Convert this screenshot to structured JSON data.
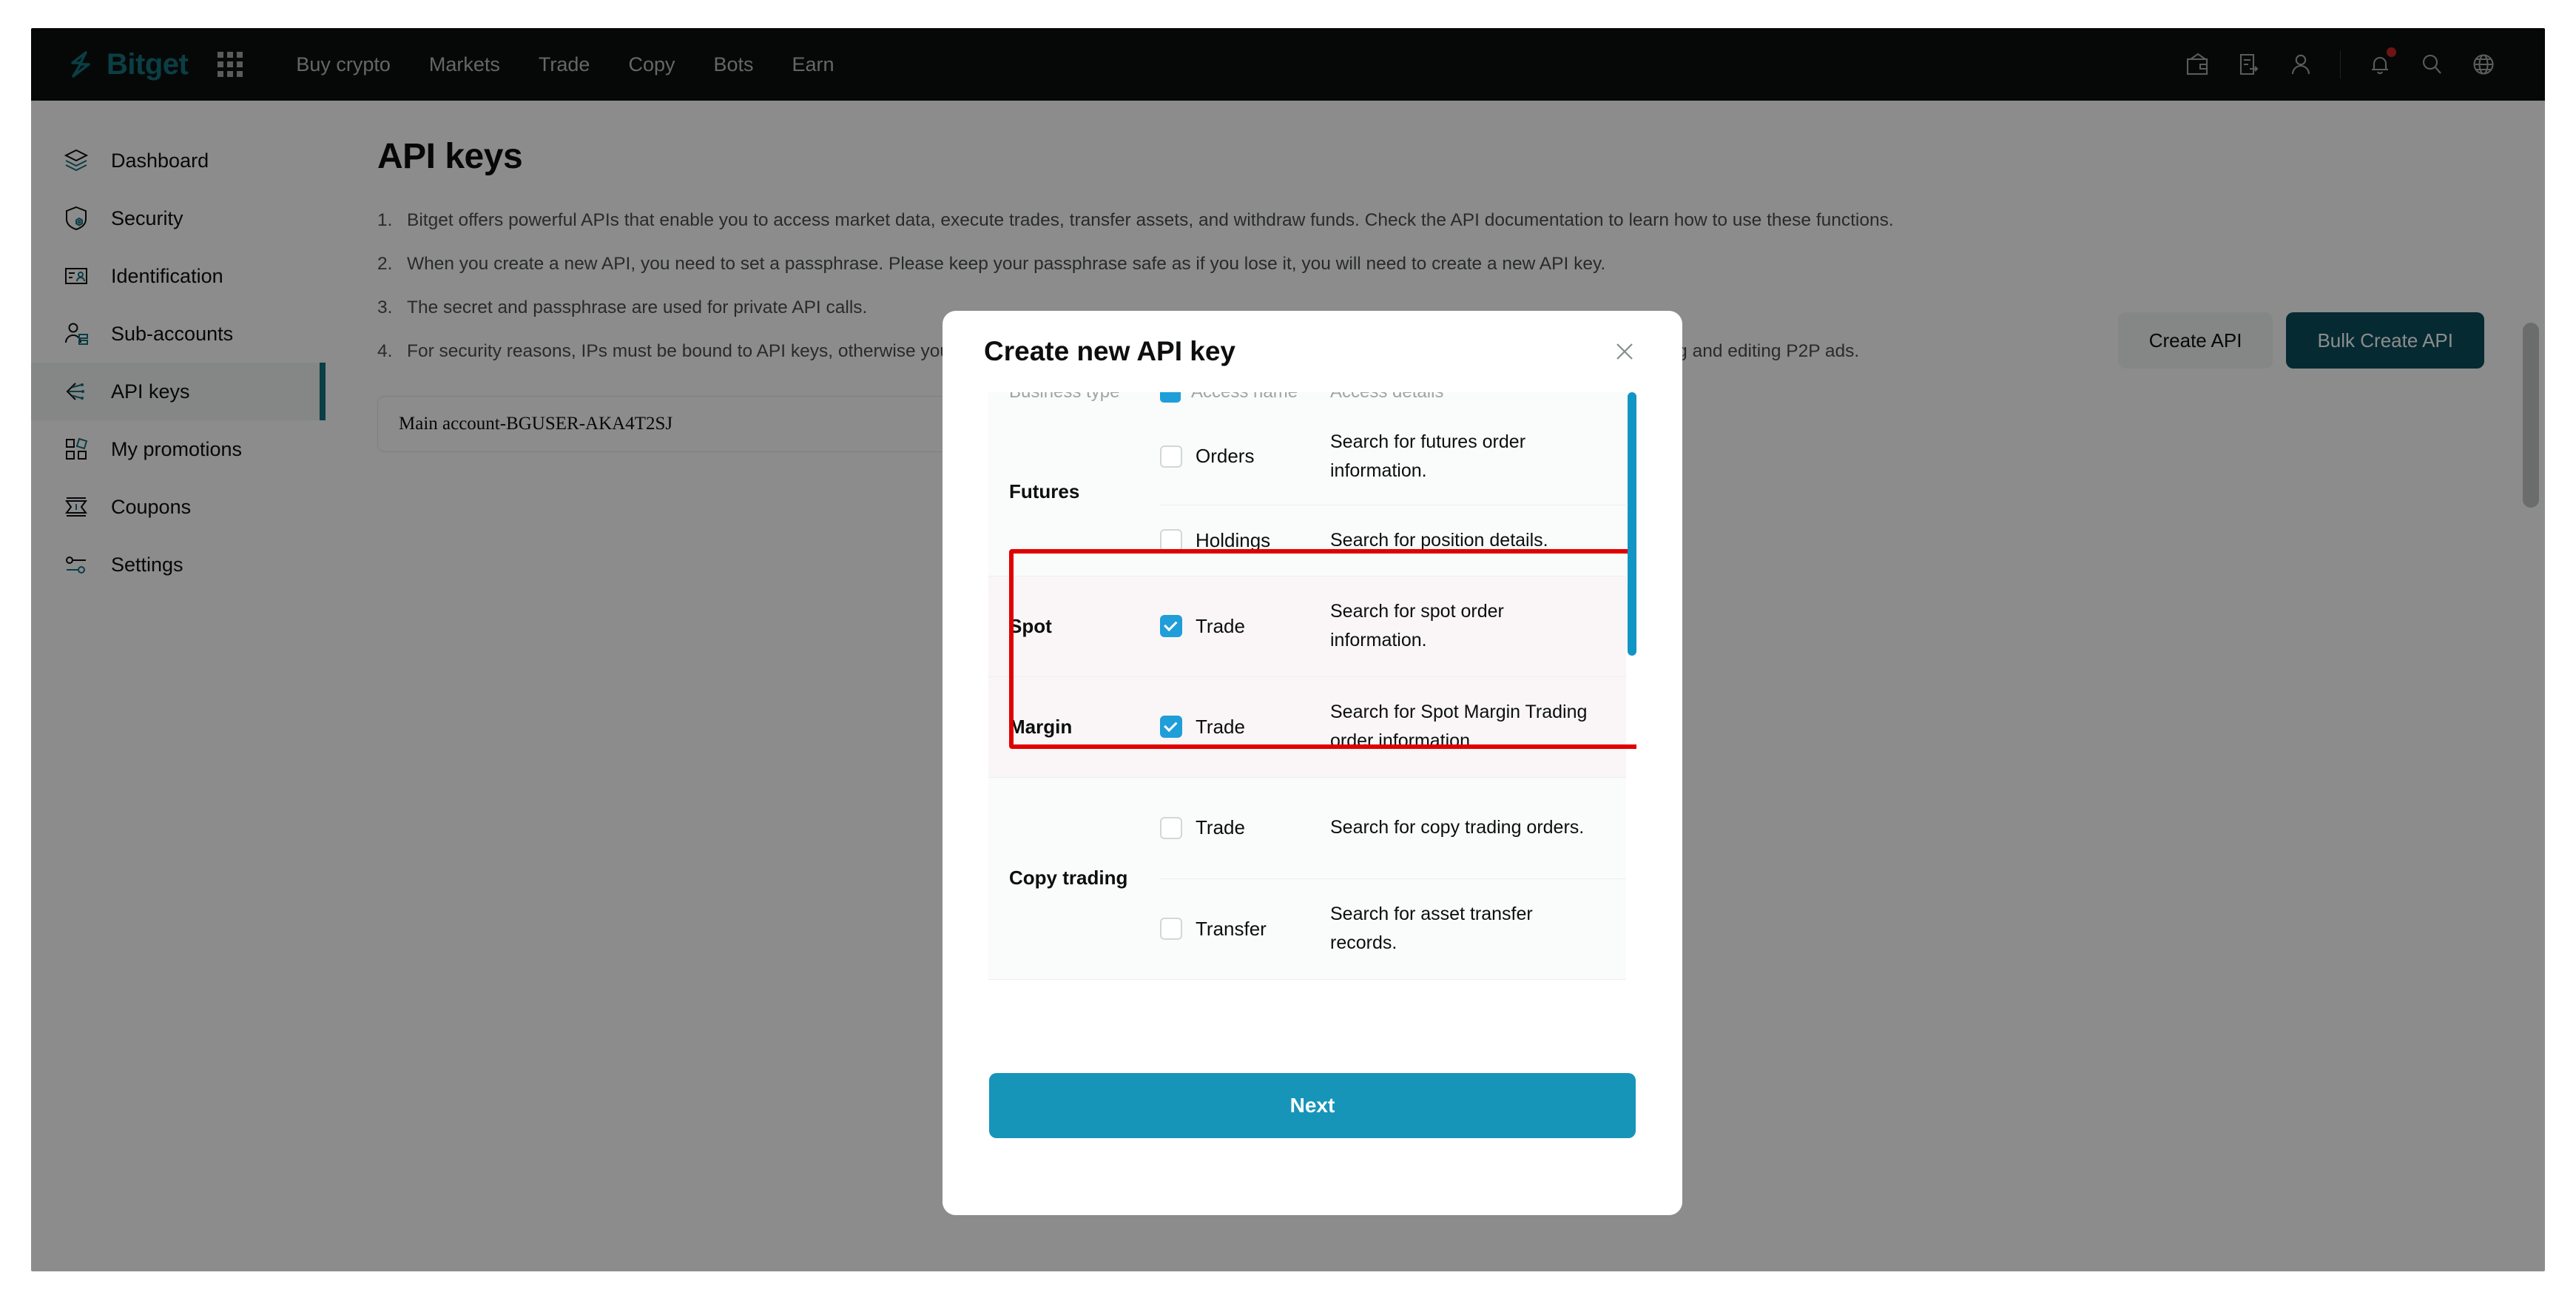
{
  "topnav": {
    "brand": "Bitget",
    "links": [
      "Buy crypto",
      "Markets",
      "Trade",
      "Copy",
      "Bots",
      "Earn"
    ],
    "icons": [
      "wallet-icon",
      "orders-icon",
      "account-icon",
      "notification-icon",
      "search-icon",
      "language-icon"
    ],
    "notification_dot_color": "#cb2527"
  },
  "sidebar": {
    "items": [
      {
        "label": "Dashboard",
        "icon": "layers-icon",
        "active": false
      },
      {
        "label": "Security",
        "icon": "shield-icon",
        "active": false
      },
      {
        "label": "Identification",
        "icon": "id-card-icon",
        "active": false
      },
      {
        "label": "Sub-accounts",
        "icon": "user-list-icon",
        "active": false
      },
      {
        "label": "API keys",
        "icon": "api-icon",
        "active": true
      },
      {
        "label": "My promotions",
        "icon": "grid-squares-icon",
        "active": false
      },
      {
        "label": "Coupons",
        "icon": "coupon-icon",
        "active": false
      },
      {
        "label": "Settings",
        "icon": "sliders-icon",
        "active": false
      }
    ],
    "active_bar_color": "#15727f"
  },
  "main": {
    "page_title": "API keys",
    "notes": [
      {
        "num": "1.",
        "text": "Bitget offers powerful APIs that enable you to access market data, execute trades, transfer assets, and withdraw funds. Check the API documentation to learn how to use these functions."
      },
      {
        "num": "2.",
        "text": "When you create a new API, you need to set a passphrase. Please keep your passphrase safe as if you lose it, you will need to create a new API key."
      },
      {
        "num": "3.",
        "text": "The secret and passphrase are used for private API calls."
      },
      {
        "num": "4.",
        "text": "For security reasons, IPs must be bound to API keys, otherwise you will be restricted from accessing certain functions, such as withdrawing assets or publishing and editing P2P ads."
      }
    ],
    "account_selected": "Main account-BGUSER-AKA4T2SJ",
    "create_api_label": "Create API",
    "bulk_create_api_label": "Bulk Create API"
  },
  "modal": {
    "title": "Create new API key",
    "close_icon": "close-icon",
    "table_headers": [
      "Business type",
      "Access name",
      "Access details"
    ],
    "rows": [
      {
        "business": "Futures",
        "entries": [
          {
            "access": "Orders",
            "detail": "Search for futures order information.",
            "checked": false
          },
          {
            "access": "Holdings",
            "detail": "Search for position details.",
            "checked": false
          }
        ],
        "highlighted": false
      },
      {
        "business": "Spot",
        "entries": [
          {
            "access": "Trade",
            "detail": "Search for spot order information.",
            "checked": true
          }
        ],
        "highlighted": true
      },
      {
        "business": "Margin",
        "entries": [
          {
            "access": "Trade",
            "detail": "Search for Spot Margin Trading order information.",
            "checked": true
          }
        ],
        "highlighted": true
      },
      {
        "business": "Copy trading",
        "entries": [
          {
            "access": "Trade",
            "detail": "Search for copy trading orders.",
            "checked": false
          },
          {
            "access": "Transfer",
            "detail": "Search for asset transfer records.",
            "checked": false
          }
        ],
        "highlighted": false
      }
    ],
    "next_label": "Next",
    "highlight_color": "#e00000",
    "accent_color": "#1f9ed9",
    "next_button_color": "#1795b9",
    "scrollbar_color": "#1195c4"
  }
}
